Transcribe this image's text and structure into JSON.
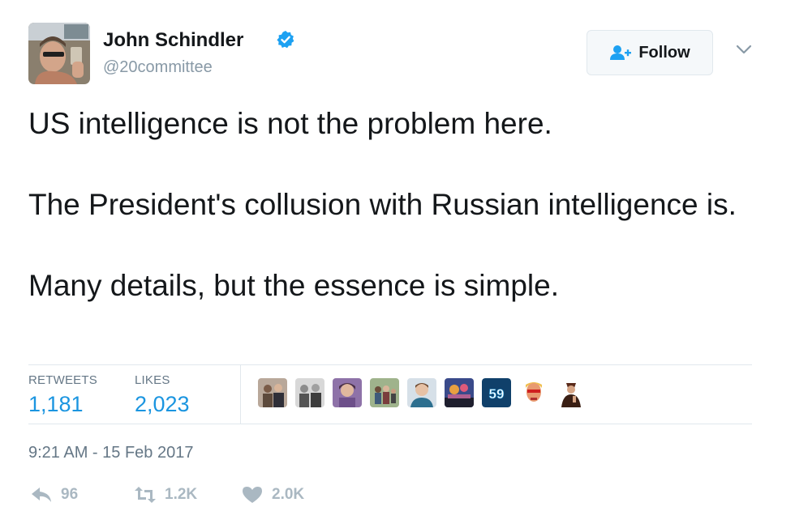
{
  "author": {
    "name": "John Schindler",
    "handle": "@20committee",
    "verified": true
  },
  "follow_button": {
    "label": "Follow"
  },
  "tweet": {
    "paragraphs": [
      "US intelligence is not the problem here.",
      "The President's collusion with Russian intelligence is.",
      "Many details, but the essence is simple."
    ]
  },
  "stats": {
    "retweets_label": "RETWEETS",
    "retweets_value": "1,181",
    "likes_label": "LIKES",
    "likes_value": "2,023"
  },
  "liker_avatars": [
    {
      "icon": "liker-avatar-1"
    },
    {
      "icon": "liker-avatar-2"
    },
    {
      "icon": "liker-avatar-3"
    },
    {
      "icon": "liker-avatar-4"
    },
    {
      "icon": "liker-avatar-5"
    },
    {
      "icon": "liker-avatar-6"
    },
    {
      "icon": "liker-avatar-7",
      "text": "59"
    },
    {
      "icon": "liker-avatar-8"
    },
    {
      "icon": "liker-avatar-9"
    }
  ],
  "timestamp": "9:21 AM - 15 Feb 2017",
  "actions": {
    "reply_count": "96",
    "retweet_count": "1.2K",
    "like_count": "2.0K"
  },
  "colors": {
    "link_blue": "#1b95e0",
    "muted_gray": "#657786",
    "action_gray": "#aab8c2",
    "verified_blue": "#1da1f2"
  }
}
